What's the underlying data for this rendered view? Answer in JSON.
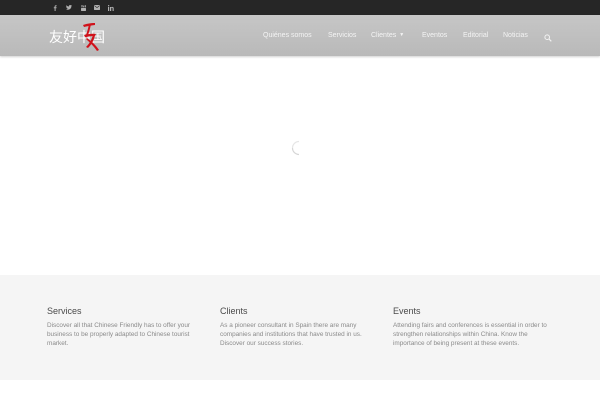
{
  "topbar": {
    "social": [
      {
        "icon": "facebook-icon",
        "glyph": "f"
      },
      {
        "icon": "twitter-icon",
        "glyph": "t"
      },
      {
        "icon": "youtube-icon",
        "glyph": "y"
      },
      {
        "icon": "email-icon",
        "glyph": "e"
      },
      {
        "icon": "linkedin-icon",
        "glyph": "in"
      }
    ]
  },
  "header": {
    "logo_text": "友好中国",
    "nav": [
      {
        "label": "Quiénes somos"
      },
      {
        "label": "Servicios"
      },
      {
        "label": "Clientes",
        "has_dropdown": true
      },
      {
        "label": "Eventos"
      },
      {
        "label": "Editorial"
      },
      {
        "label": "Noticias"
      }
    ]
  },
  "footer": {
    "columns": [
      {
        "title": "Services",
        "text": "Discover all that Chinese Friendly has to offer your business to be properly adapted to Chinese tourist market."
      },
      {
        "title": "Clients",
        "text": "As a pioneer consultant in Spain there are many companies and institutions that have trusted in us. Discover our success stories."
      },
      {
        "title": "Events",
        "text": "Attending fairs and conferences is essential in order to strengthen relationships within China. Know the importance of being present at these events."
      }
    ]
  },
  "colors": {
    "topbar_bg": "#262626",
    "header_bg": "#bfbfbf",
    "footer_bg": "#f5f5f5",
    "logo_accent": "#d0121b"
  }
}
